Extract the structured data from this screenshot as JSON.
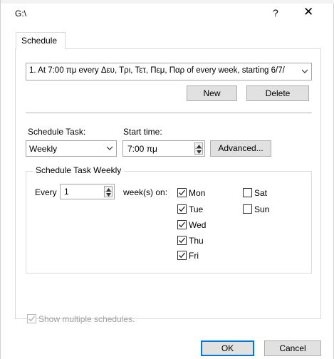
{
  "window": {
    "title": "G:\\",
    "help_label": "?",
    "close_label": "✕"
  },
  "tabs": [
    {
      "label": "Schedule",
      "active": true
    }
  ],
  "schedule": {
    "selected": "1. At 7:00 πμ every Δευ, Τρι, Τετ, Πεμ, Παρ of every week, starting 6/7/"
  },
  "buttons": {
    "new": "New",
    "delete": "Delete",
    "advanced": "Advanced...",
    "ok": "OK",
    "cancel": "Cancel"
  },
  "task": {
    "schedule_task_label": "Schedule Task:",
    "schedule_task_value": "Weekly",
    "start_time_label": "Start time:",
    "start_time_value": "7:00 πμ"
  },
  "weekly": {
    "group_label": "Schedule Task Weekly",
    "every_label": "Every",
    "every_value": "1",
    "weeks_on_label": "week(s) on:",
    "days": [
      {
        "label": "Mon",
        "checked": true
      },
      {
        "label": "Tue",
        "checked": true
      },
      {
        "label": "Wed",
        "checked": true
      },
      {
        "label": "Thu",
        "checked": true
      },
      {
        "label": "Fri",
        "checked": true
      },
      {
        "label": "Sat",
        "checked": false
      },
      {
        "label": "Sun",
        "checked": false
      }
    ]
  },
  "footer": {
    "show_multiple_label": "Show multiple schedules.",
    "show_multiple_checked": true,
    "show_multiple_disabled": true
  },
  "colors": {
    "accent": "#0078d7",
    "button_face": "#e1e1e1",
    "border": "#a6a6a6"
  }
}
